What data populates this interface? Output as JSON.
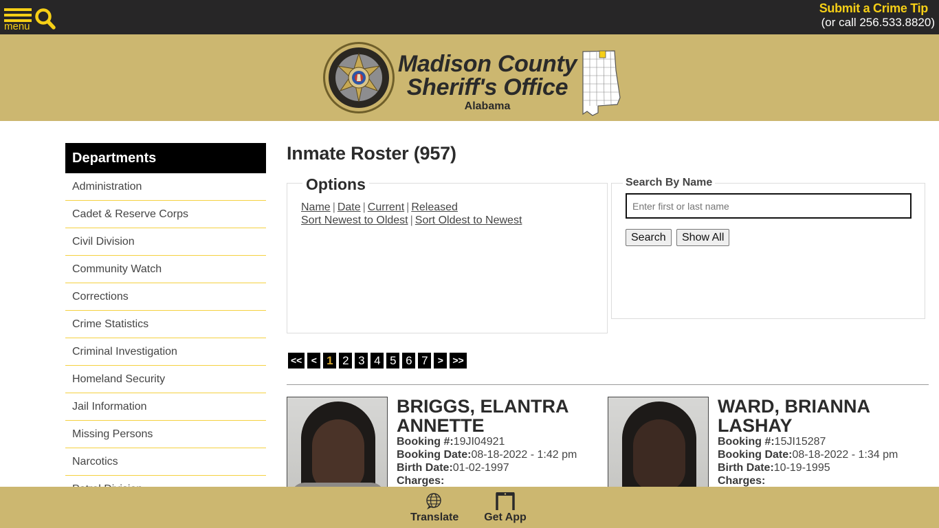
{
  "topbar": {
    "menu_label": "menu",
    "crime_tip_label": "Submit a Crime Tip",
    "crime_tip_phone": "(or call 256.533.8820)",
    "accent_color": "#f6cf16"
  },
  "banner": {
    "title_line1": "Madison County",
    "title_line2": "Sheriff's Office",
    "state": "Alabama",
    "seal_alt": "Madison County Sheriff's Office seal",
    "map_alt": "Alabama county map with Madison County highlighted"
  },
  "sidebar": {
    "heading": "Departments",
    "items": [
      {
        "label": "Administration"
      },
      {
        "label": "Cadet & Reserve Corps"
      },
      {
        "label": "Civil Division"
      },
      {
        "label": "Community Watch"
      },
      {
        "label": "Corrections"
      },
      {
        "label": "Crime Statistics"
      },
      {
        "label": "Criminal Investigation"
      },
      {
        "label": "Homeland Security"
      },
      {
        "label": "Jail Information"
      },
      {
        "label": "Missing Persons"
      },
      {
        "label": "Narcotics"
      },
      {
        "label": "Patrol Division"
      }
    ]
  },
  "main": {
    "title": "Inmate Roster (957)",
    "options": {
      "legend": "Options",
      "filter_links": [
        "Name",
        "Date",
        "Current",
        "Released"
      ],
      "sort_links": [
        "Sort Newest to Oldest",
        "Sort Oldest to Newest"
      ]
    },
    "search": {
      "legend": "Search By Name",
      "placeholder": "Enter first or last name",
      "value": "",
      "search_label": "Search",
      "show_all_label": "Show All"
    },
    "pagination": {
      "first": "<<",
      "prev": "<",
      "pages": [
        "1",
        "2",
        "3",
        "4",
        "5",
        "6",
        "7"
      ],
      "current": "1",
      "next": ">",
      "last": ">>"
    },
    "inmates": [
      {
        "name": "BRIGGS, ELANTRA ANNETTE",
        "booking_label": "Booking #:",
        "booking_number": "19JI04921",
        "booking_date_label": "Booking Date:",
        "booking_date": "08-18-2022 - 1:42 pm",
        "birth_date_label": "Birth Date:",
        "birth_date": "01-02-1997",
        "charges_label": "Charges:"
      },
      {
        "name": "WARD, BRIANNA LASHAY",
        "booking_label": "Booking #:",
        "booking_number": "15JI15287",
        "booking_date_label": "Booking Date:",
        "booking_date": "08-18-2022 - 1:34 pm",
        "birth_date_label": "Birth Date:",
        "birth_date": "10-19-1995",
        "charges_label": "Charges:"
      }
    ]
  },
  "footer": {
    "translate_label": "Translate",
    "get_app_label": "Get App"
  }
}
